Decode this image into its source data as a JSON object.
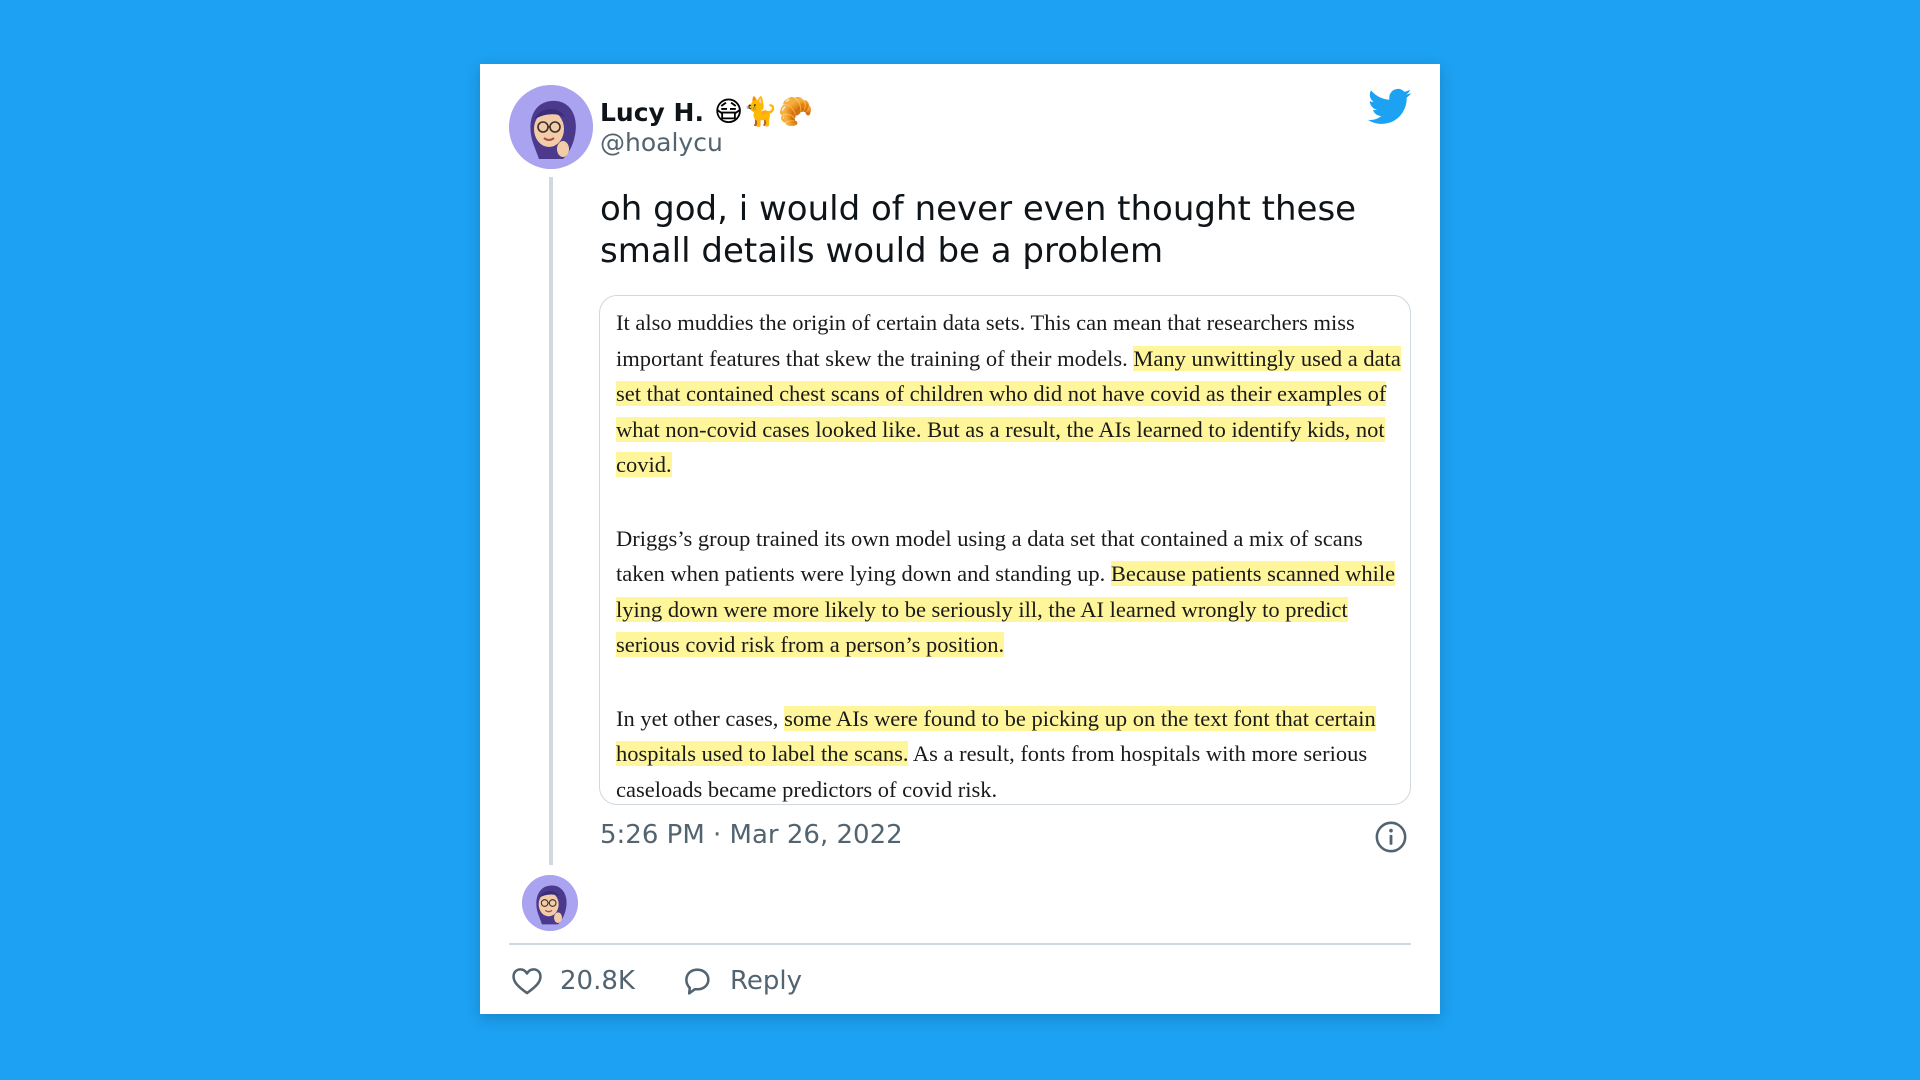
{
  "colors": {
    "background": "#1da1f2",
    "card": "#ffffff",
    "highlight": "#fff59a",
    "muted_text": "#536471",
    "twitter_blue": "#1da1f2"
  },
  "author": {
    "display_name": "Lucy H.",
    "emojis": "😷🐈🥐",
    "handle": "@hoalycu",
    "avatar_icon": "memoji-avatar"
  },
  "brand_icon": "twitter-bird-icon",
  "tweet": {
    "text": "oh god, i would of never even thought these small details would be a problem",
    "timestamp": "5:26 PM · Mar 26, 2022"
  },
  "screenshot_article": {
    "p1_plain": "It also muddies the origin of certain data sets. This can mean that researchers miss important features that skew the training of their models. ",
    "p1_highlight": "Many unwittingly used a data set that contained chest scans of children who did not have covid as their examples of what non-covid cases looked like. But as a result, the AIs learned to identify kids, not covid.",
    "p2_plain": "Driggs’s group trained its own model using a data set that contained a mix of scans taken when patients were lying down and standing up. ",
    "p2_highlight": "Because patients scanned while lying down were more likely to be seriously ill, the AI learned wrongly to predict serious covid risk from a person’s position.",
    "p3_plain_start": "In yet other cases, ",
    "p3_highlight": "some AIs were found to be picking up on the text font that certain hospitals used to label the scans.",
    "p3_plain_end": " As a result, fonts from hospitals with more serious caseloads became predictors of covid risk."
  },
  "actions": {
    "like_count": "20.8K",
    "reply_label": "Reply",
    "like_icon": "heart-icon",
    "reply_icon": "speech-bubble-icon",
    "info_icon": "info-icon"
  }
}
